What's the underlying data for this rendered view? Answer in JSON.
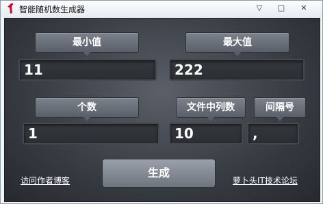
{
  "window": {
    "title": "智能随机数生成器",
    "minimize_glyph": "▽",
    "restore_glyph": "□",
    "close_glyph": "✕"
  },
  "labels": {
    "min": "最小值",
    "max": "最大值",
    "count": "个数",
    "columns": "文件中列数",
    "separator": "间隔号"
  },
  "fields": {
    "min_value": "11",
    "max_value": "222",
    "count_value": "1",
    "columns_value": "10",
    "separator_value": ","
  },
  "actions": {
    "generate": "生成",
    "visit_blog": "访问作者博客",
    "forum": "萝卜头IT技术论坛"
  },
  "icons": {
    "app": "red-figure-icon",
    "minimize": "minimize-icon",
    "restore": "restore-icon",
    "close": "close-icon"
  }
}
